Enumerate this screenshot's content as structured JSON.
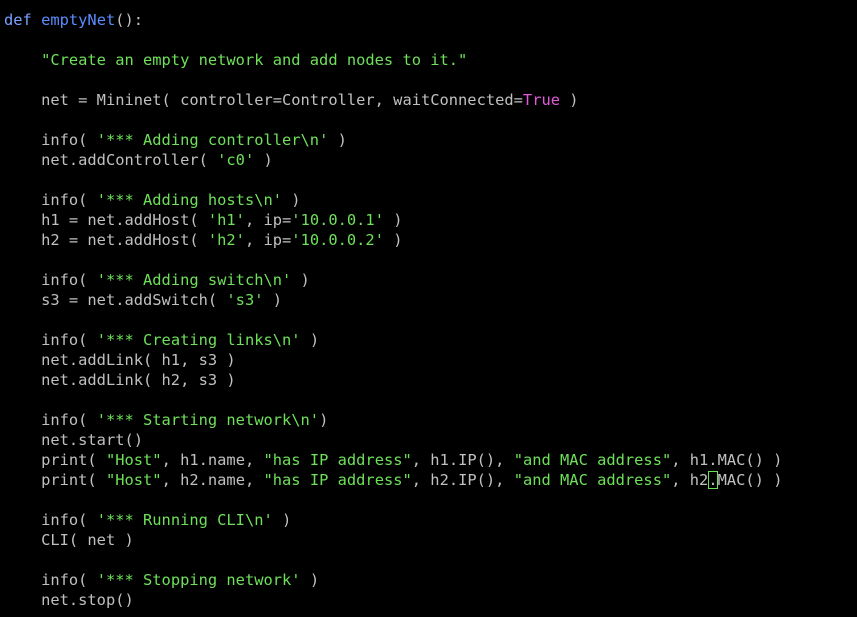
{
  "colors": {
    "background": "#000000",
    "text": "#c0c0c0",
    "keyword": "#7aa0ff",
    "function_name": "#5a8cff",
    "string": "#6ee05a",
    "constant": "#e25ad9",
    "cursor": "#6ee05a"
  },
  "code": {
    "l1": {
      "kw": "def",
      "fn": "emptyNet",
      "rest": "():"
    },
    "l2": {
      "s1": "\"Create an empty network and add nodes to it.\""
    },
    "l3": {
      "t1": "net = Mininet( controller=Controller, waitConnected=",
      "c1": "True",
      "t2": " )"
    },
    "l4": {
      "t1": "info( ",
      "s1": "'*** Adding controller\\n'",
      "t2": " )"
    },
    "l5": {
      "t1": "net.addController( ",
      "s1": "'c0'",
      "t2": " )"
    },
    "l6": {
      "t1": "info( ",
      "s1": "'*** Adding hosts\\n'",
      "t2": " )"
    },
    "l7": {
      "t1": "h1 = net.addHost( ",
      "s1": "'h1'",
      "t2": ", ip=",
      "s2": "'10.0.0.1'",
      "t3": " )"
    },
    "l8": {
      "t1": "h2 = net.addHost( ",
      "s1": "'h2'",
      "t2": ", ip=",
      "s2": "'10.0.0.2'",
      "t3": " )"
    },
    "l9": {
      "t1": "info( ",
      "s1": "'*** Adding switch\\n'",
      "t2": " )"
    },
    "l10": {
      "t1": "s3 = net.addSwitch( ",
      "s1": "'s3'",
      "t2": " )"
    },
    "l11": {
      "t1": "info( ",
      "s1": "'*** Creating links\\n'",
      "t2": " )"
    },
    "l12": {
      "t1": "net.addLink( h1, s3 )"
    },
    "l13": {
      "t1": "net.addLink( h2, s3 )"
    },
    "l14": {
      "t1": "info( ",
      "s1": "'*** Starting network\\n'",
      "t2": ")"
    },
    "l15": {
      "t1": "net.start()"
    },
    "l16": {
      "t1": "print( ",
      "s1": "\"Host\"",
      "t2": ", h1.name, ",
      "s2": "\"has IP address\"",
      "t3": ", h1.IP(), ",
      "s3": "\"and MAC address\"",
      "t4": ", h1.MAC() )"
    },
    "l17": {
      "t1": "print( ",
      "s1": "\"Host\"",
      "t2": ", h2.name, ",
      "s2": "\"has IP address\"",
      "t3": ", h2.IP(), ",
      "s3": "\"and MAC address\"",
      "t4a": ", h2",
      "cur": ".",
      "t4b": "MAC() )"
    },
    "l18": {
      "t1": "info( ",
      "s1": "'*** Running CLI\\n'",
      "t2": " )"
    },
    "l19": {
      "t1": "CLI( net )"
    },
    "l20": {
      "t1": "info( ",
      "s1": "'*** Stopping network'",
      "t2": " )"
    },
    "l21": {
      "t1": "net.stop()"
    }
  }
}
